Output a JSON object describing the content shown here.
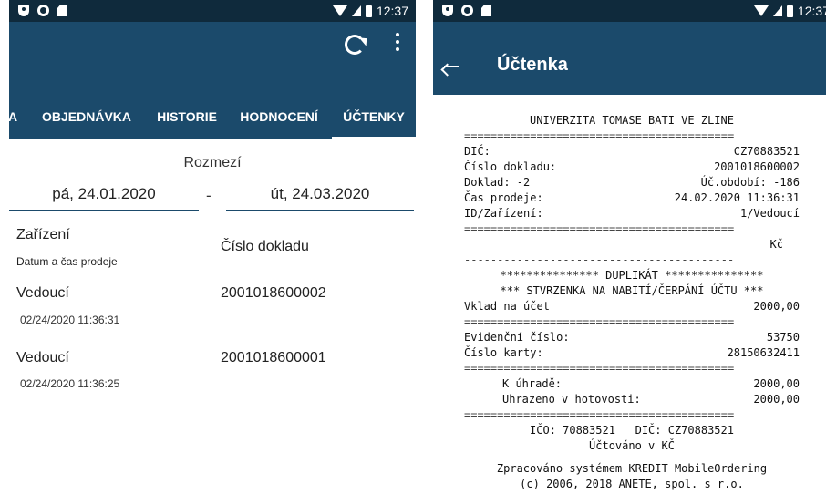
{
  "status_left": {
    "time": "12:37"
  },
  "status_right": {
    "time": "12:37"
  },
  "left": {
    "tabs": [
      {
        "label": "A"
      },
      {
        "label": "OBJEDNÁVKA"
      },
      {
        "label": "HISTORIE"
      },
      {
        "label": "HODNOCENÍ"
      },
      {
        "label": "ÚČTENKY"
      }
    ],
    "period_label": "Rozmezí",
    "date_from": "pá, 24.01.2020",
    "date_sep": "-",
    "date_to": "út, 24.03.2020",
    "col_device": "Zařízení",
    "col_datetime": "Datum a čas prodeje",
    "col_docnum": "Číslo dokladu",
    "rows": [
      {
        "name": "Vedoucí",
        "date": "02/24/2020 11:36:31",
        "number": "2001018600002"
      },
      {
        "name": "Vedoucí",
        "date": "02/24/2020 11:36:25",
        "number": "2001018600001"
      }
    ]
  },
  "right": {
    "title": "Účtenka",
    "receipt": {
      "header": "UNIVERZITA TOMASE BATI VE ZLINE",
      "sep": "=========================================",
      "dash": "-----------------------------------------",
      "dic_label": "DIČ:",
      "dic_value": "CZ70883521",
      "doc_label": "Číslo dokladu:",
      "doc_value": "2001018600002",
      "doklad_label": "Doklad: -2",
      "doklad_value": "Úč.období: -186",
      "time_label": "Čas prodeje:",
      "time_value": "24.02.2020 11:36:31",
      "id_label": "ID/Zařízení:",
      "id_value": "1/Vedoucí",
      "currency": "Kč",
      "duplicate": "*************** DUPLIKÁT ***************",
      "confirm": "*** STVRZENKA NA NABITÍ/ČERPÁNÍ ÚČTU ***",
      "deposit_label": "Vklad na účet",
      "deposit_value": "2000,00",
      "evid_label": "Evidenční číslo:",
      "evid_value": "53750",
      "card_label": "Číslo karty:",
      "card_value": "28150632411",
      "pay_label": "K úhradě:",
      "pay_value": "2000,00",
      "cash_label": "Uhrazeno v hotovosti:",
      "cash_value": "2000,00",
      "ico_line": "IČO: 70883521   DIČ: CZ70883521",
      "account_line": "Účtováno v KČ",
      "processed_line": "Zpracováno systémem KREDIT MobileOrdering",
      "copyright_line": "(c) 2006, 2018 ANETE, spol. s r.o."
    }
  }
}
